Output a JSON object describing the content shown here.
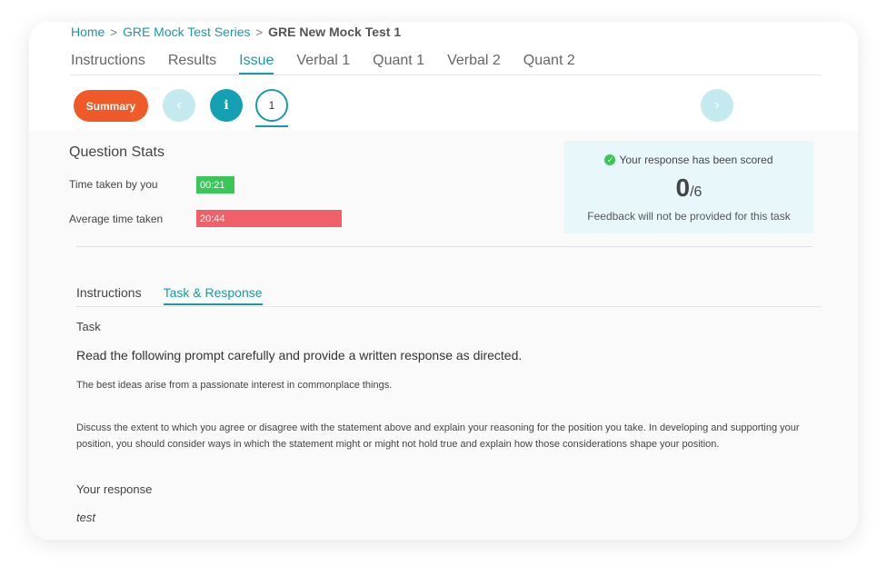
{
  "breadcrumb": {
    "home": "Home",
    "series": "GRE Mock Test Series",
    "current": "GRE New Mock Test 1",
    "sep": ">"
  },
  "tabs": [
    "Instructions",
    "Results",
    "Issue",
    "Verbal 1",
    "Quant 1",
    "Verbal 2",
    "Quant 2"
  ],
  "active_tab": "Issue",
  "nav": {
    "summary_label": "Summary",
    "prev_icon": "‹",
    "info_icon": "i",
    "question_number": "1",
    "next_icon": "›"
  },
  "stats": {
    "title": "Question Stats",
    "time_label": "Time taken by you",
    "time_value": "00:21",
    "avg_label": "Average time taken",
    "avg_value": "20:44"
  },
  "score": {
    "status": "Your response has been scored",
    "score": "0",
    "total": "/6",
    "feedback": "Feedback will not be provided for this task"
  },
  "subtabs": [
    "Instructions",
    "Task & Response"
  ],
  "task": {
    "label": "Task",
    "directive": "Read the following prompt carefully and provide a written response as directed.",
    "statement": "The best ideas arise from a passionate interest in commonplace things.",
    "instructions": "Discuss the extent to which you agree or disagree with the statement above and explain your reasoning for the position you take. In developing and supporting your position, you should consider ways in which the statement might or might not hold true and explain how those considerations shape your position."
  },
  "response": {
    "label": "Your response",
    "text": "test"
  },
  "colors": {
    "accent": "#1a9aa8",
    "summary": "#f05a28",
    "green": "#3cc65a",
    "red": "#f0606a"
  }
}
